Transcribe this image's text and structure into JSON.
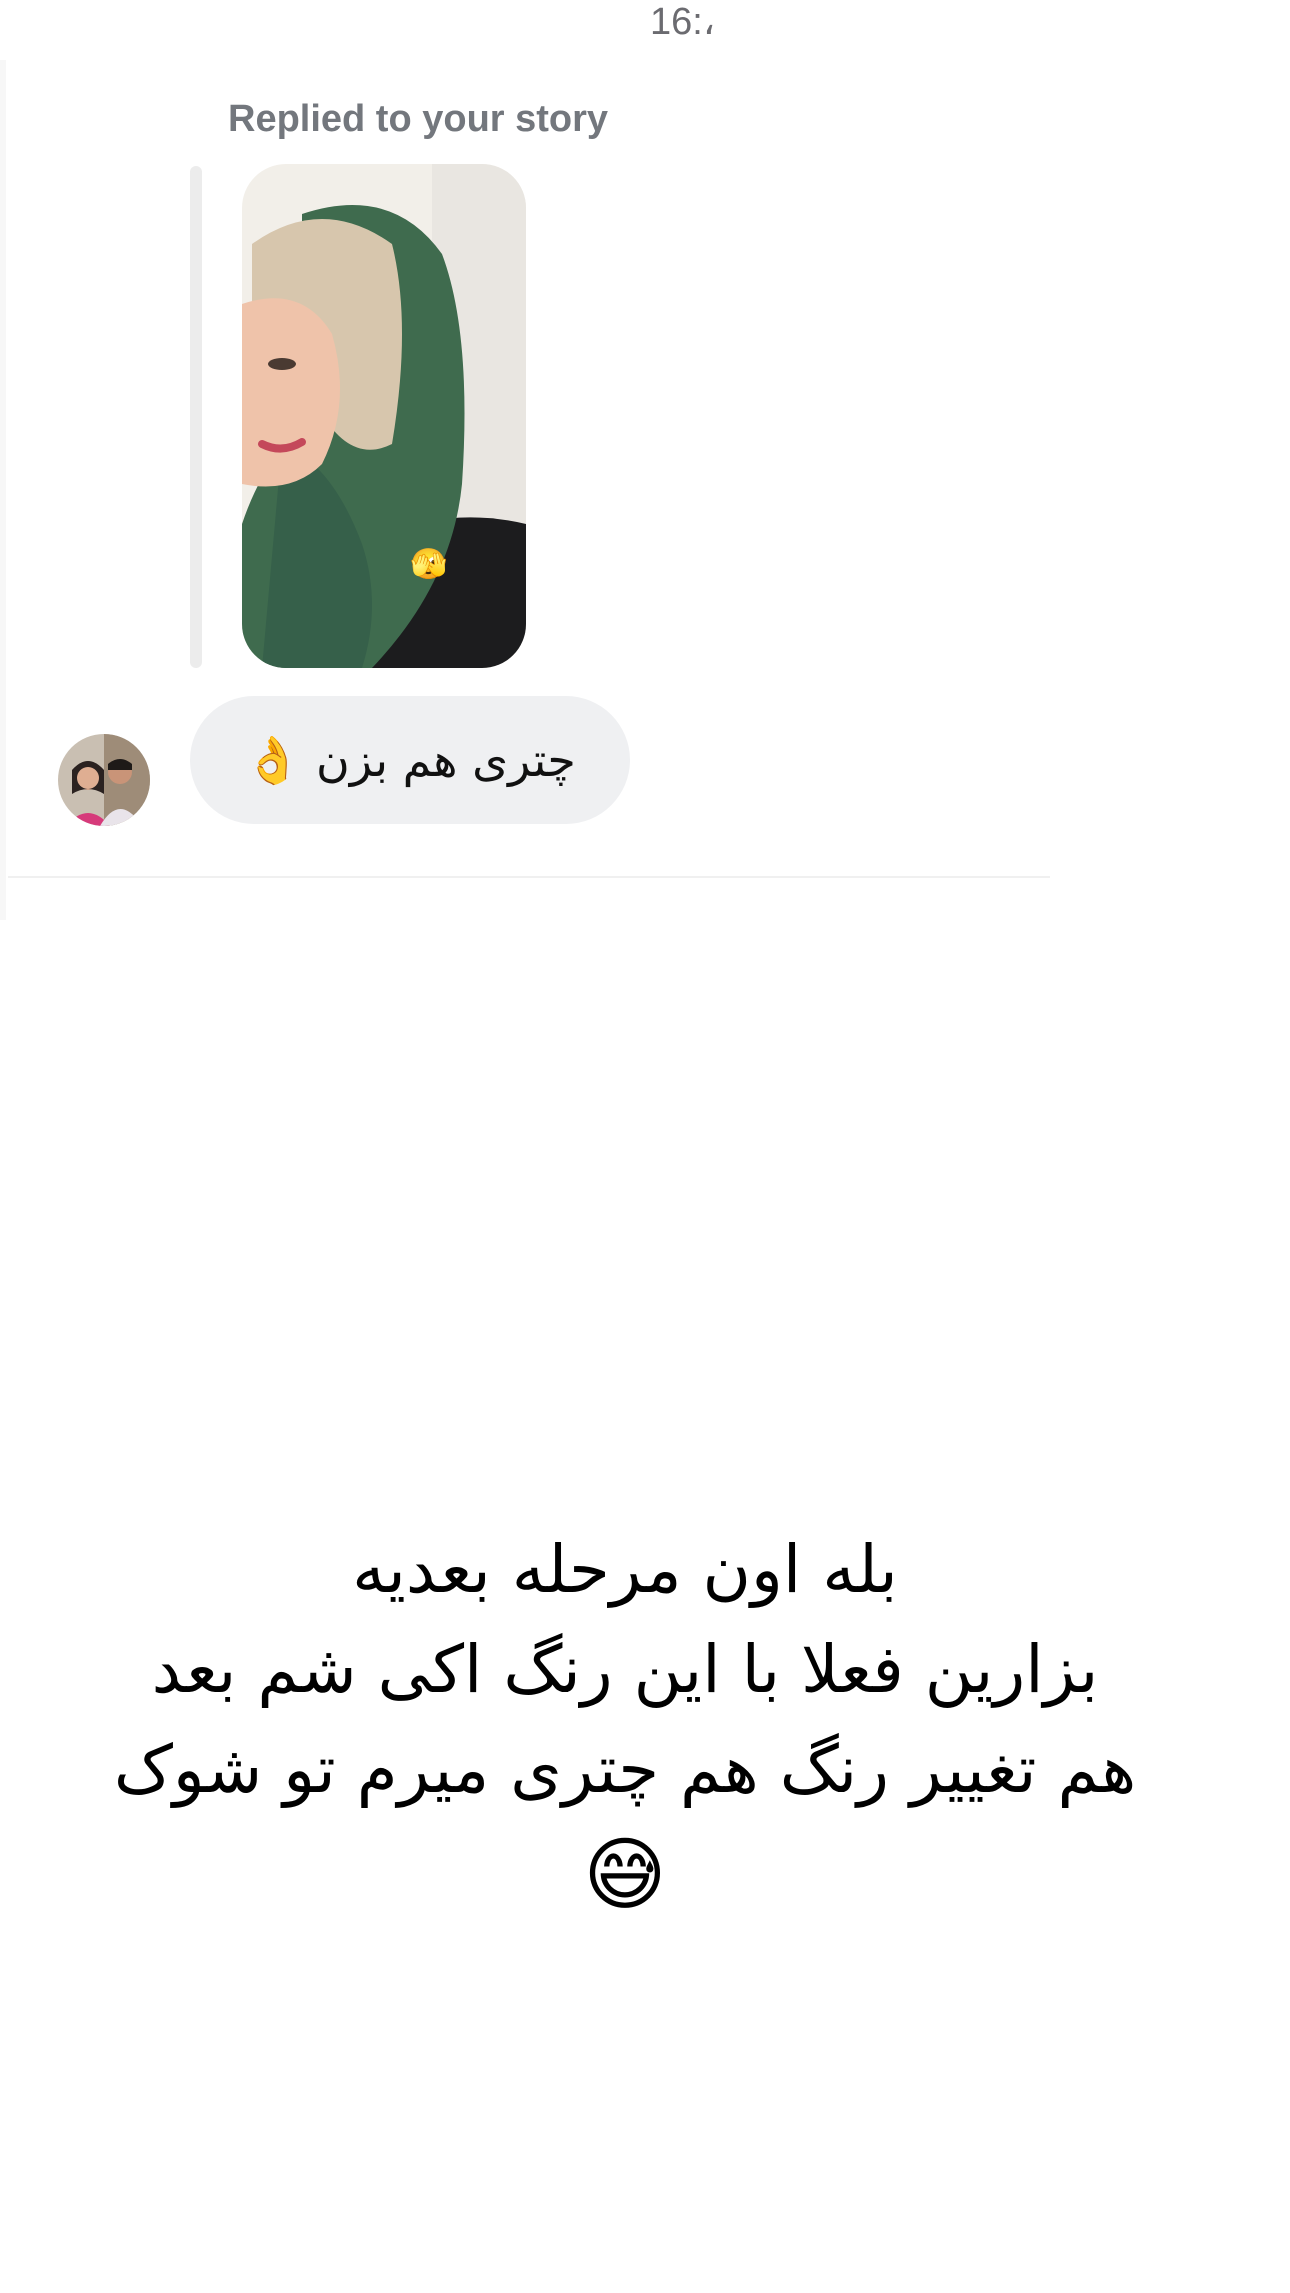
{
  "status_bar": {
    "time": "16:،"
  },
  "reply": {
    "caption": "Replied to your story",
    "story_emoji": "🫣",
    "colors": {
      "scarf": "#3f6b4e",
      "hair": "#d7c6ad",
      "background": "#f2efe9"
    }
  },
  "message": {
    "text": "چترى هم بزن 👌"
  },
  "annotation": {
    "lines": [
      "بله اون مرحله بعديه",
      "بزارين فعلا با اين رنگ اكى شم بعد",
      "هم تغيير رنگ هم چترى ميرم تو شوک",
      "😅"
    ]
  }
}
